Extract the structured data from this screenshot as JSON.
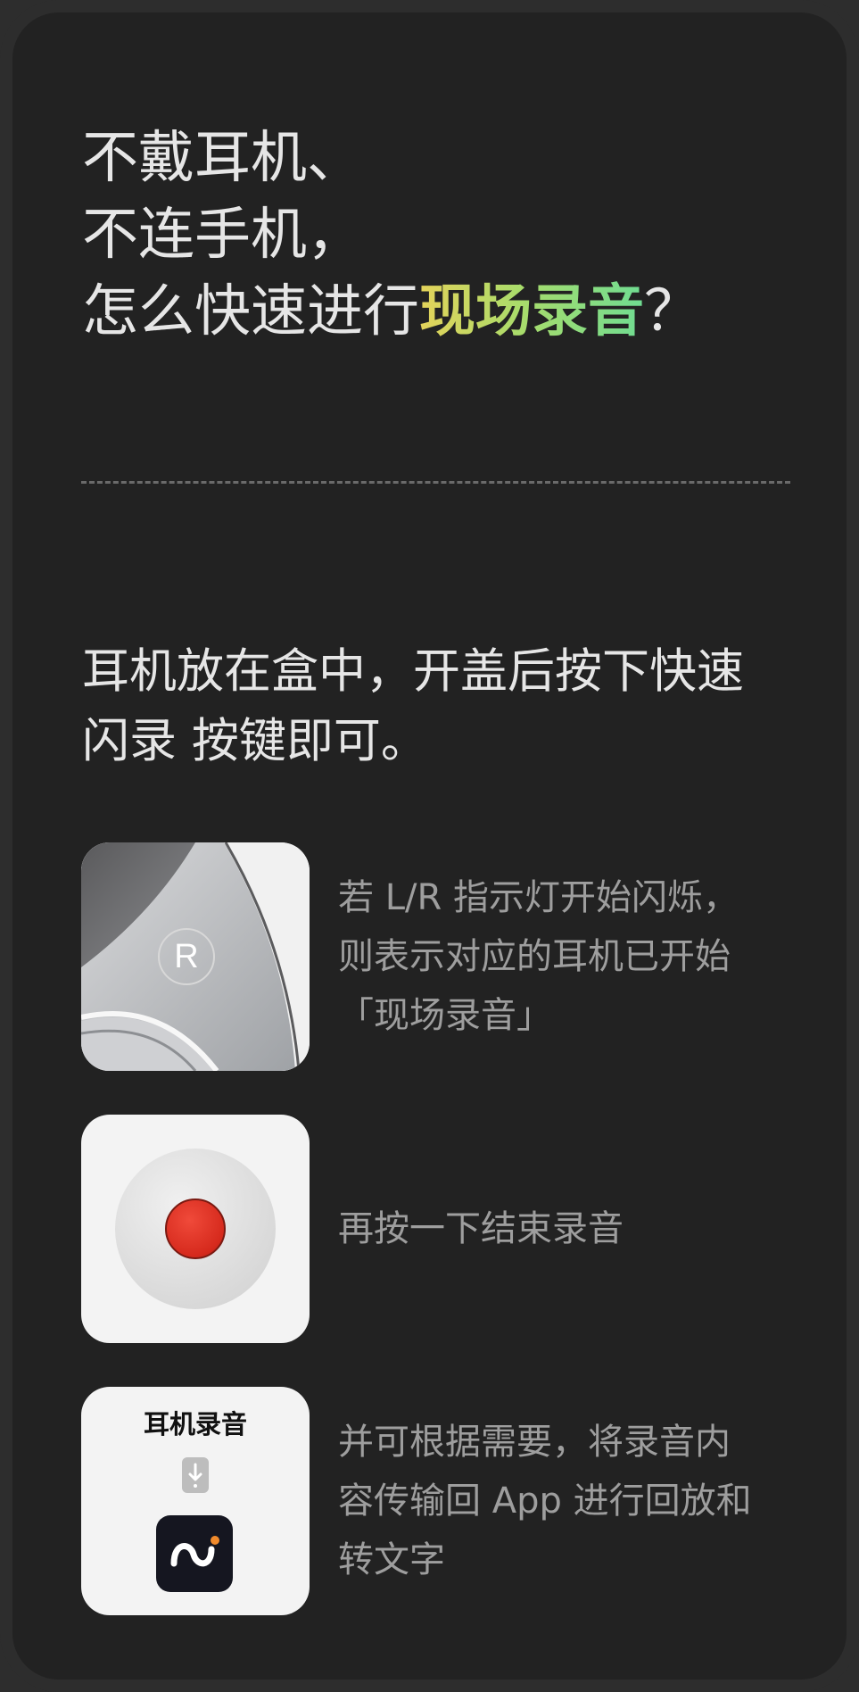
{
  "headline": {
    "line1": "不戴耳机、",
    "line2": "不连手机，",
    "line3_prefix": "怎么快速进行",
    "line3_highlight": "现场录音",
    "line3_suffix": "？"
  },
  "instruction": {
    "line1": "耳机放在盒中，开盖后按下快速",
    "line2": "闪录 按键即可。"
  },
  "steps": [
    {
      "icon": "earbud-r-button",
      "button_letter": "R",
      "lines": [
        "若 L/R 指示灯开始闪烁，",
        "则表示对应的耳机已开始",
        "「现场录音」"
      ]
    },
    {
      "icon": "record-button",
      "lines": [
        "再按一下结束录音"
      ]
    },
    {
      "icon": "app-transfer",
      "card_title": "耳机录音",
      "lines": [
        "并可根据需要，将录音内",
        "容传输回 App 进行回放和",
        "转文字"
      ]
    }
  ],
  "colors": {
    "background": "#222222",
    "frame": "#2d2d2d",
    "text_primary": "#e6e6e6",
    "text_secondary": "#9e9e9e",
    "highlight_start": "#e4d35a",
    "highlight_end": "#6fdc92",
    "record_red": "#d62a1d"
  }
}
